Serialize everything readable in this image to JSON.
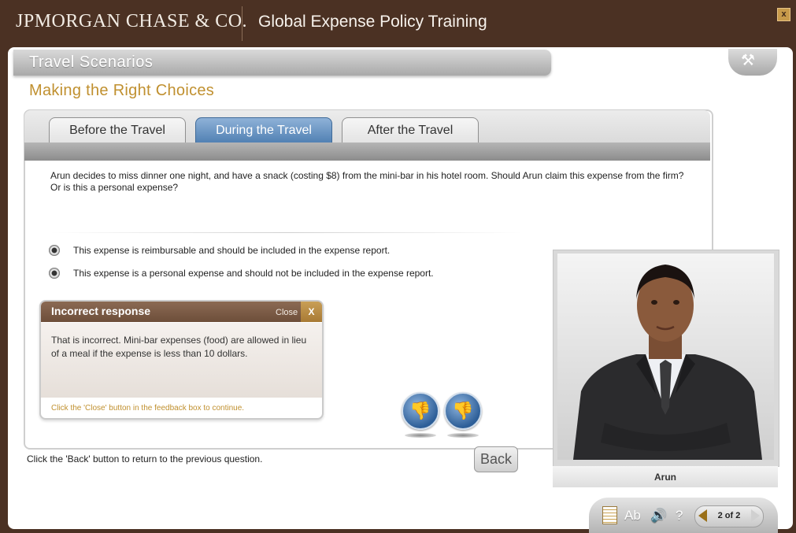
{
  "header": {
    "logo_text": "JPMORGAN CHASE & CO.",
    "course_title": "Global Expense Policy Training",
    "close_label": "x"
  },
  "section": {
    "title": "Travel Scenarios",
    "subtitle": "Making the Right Choices",
    "tools_icon": "tools-icon"
  },
  "tabs": [
    {
      "label": "Before the Travel",
      "state": "inactive"
    },
    {
      "label": "During the Travel",
      "state": "active"
    },
    {
      "label": "After the Travel",
      "state": "inactive"
    }
  ],
  "question": {
    "text": "Arun decides to miss dinner one night, and have a snack (costing $8) from the mini-bar in his hotel room. Should Arun claim this expense from the firm? Or is this a personal expense?",
    "options": [
      {
        "label": "This expense is reimbursable and should be included in the expense report.",
        "selected": false
      },
      {
        "label": "This expense is a personal expense and should not be included in the expense report.",
        "selected": true
      }
    ]
  },
  "feedback": {
    "title": "Incorrect response",
    "close_label": "Close",
    "close_x": "X",
    "body": "That is incorrect. Mini-bar expenses (food) are allowed in lieu of a meal if the expense is less than 10 dollars.",
    "footer": "Click the 'Close' button in the feedback box to continue."
  },
  "instruction": "Click the 'Back' button to return to the previous question.",
  "back_label": "Back",
  "character": {
    "name": "Arun"
  },
  "toolbar": {
    "text_size_label": "Ab",
    "audio_icon": "speaker-icon",
    "help_label": "?",
    "page_indicator": "2 of 2"
  },
  "colors": {
    "header_bg": "#4b3123",
    "accent_gold": "#c0902f",
    "active_tab": "#4f7fb2",
    "feedback_header": "#6d4e3a"
  }
}
